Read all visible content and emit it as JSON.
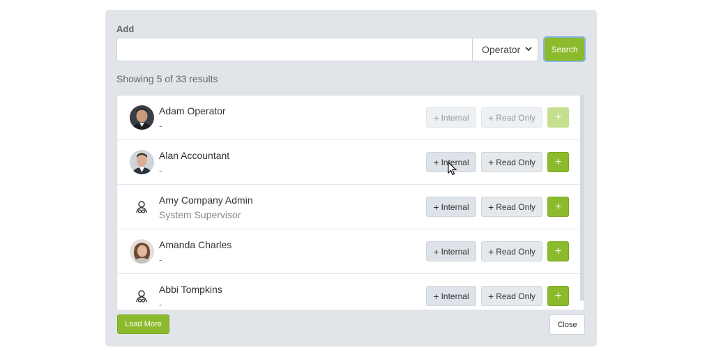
{
  "dialog": {
    "add_label": "Add",
    "search": {
      "value": "",
      "placeholder": ""
    },
    "role_select": {
      "selected": "Operator"
    },
    "search_button": "Search",
    "results_text": "Showing 5 of 33 results",
    "load_more": "Load More",
    "close": "Close"
  },
  "users": [
    {
      "name": "Adam Operator",
      "subtitle": "-",
      "avatar": "photo-man-beard",
      "disabled": true
    },
    {
      "name": "Alan Accountant",
      "subtitle": "-",
      "avatar": "photo-man-suit",
      "disabled": false
    },
    {
      "name": "Amy Company Admin",
      "subtitle": "System Supervisor",
      "avatar": "user-icon",
      "disabled": false
    },
    {
      "name": "Amanda Charles",
      "subtitle": "-",
      "avatar": "photo-woman",
      "disabled": false
    },
    {
      "name": "Abbi Tompkins",
      "subtitle": "-",
      "avatar": "user-icon",
      "disabled": false
    }
  ],
  "row_buttons": {
    "internal": "Internal",
    "read_only": "Read Only",
    "plus": "+"
  },
  "colors": {
    "accent": "#8bbb2c",
    "panel": "#e1e5e9"
  }
}
